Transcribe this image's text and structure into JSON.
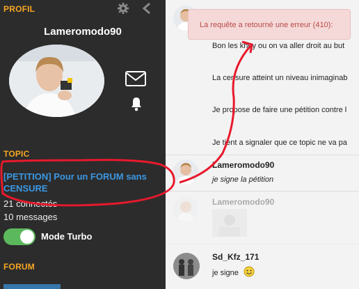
{
  "sidebar": {
    "profile_title": "PROFIL",
    "username": "Lameromodo90",
    "topic_title": "TOPIC",
    "topic_link": "[PETITION] Pour un FORUM sans CENSURE",
    "connected": "21 connectés",
    "messages": "10 messages",
    "turbo_label": "Mode Turbo",
    "turbo_on": true,
    "forum_title": "FORUM"
  },
  "error": {
    "text": "La requête a retourné une erreur (410):"
  },
  "posts": [
    {
      "lines": [
        "Bon les khey ou on va aller droit au but",
        "La censure atteint un niveau inimaginab",
        "Je propose de faire une pétition contre l",
        "Je tient a signaler que ce topic ne va pa"
      ]
    },
    {
      "author": "Lameromodo90",
      "text": "je signe la pétition"
    },
    {
      "author": "Lameromodo90"
    },
    {
      "author": "Sd_Kfz_171",
      "text": "je signe"
    }
  ],
  "colors": {
    "accent": "#f5a623",
    "link": "#3b97e3",
    "toggle": "#5cb85c",
    "error_bg": "#f5d9d9",
    "annotation": "#e8192c"
  }
}
